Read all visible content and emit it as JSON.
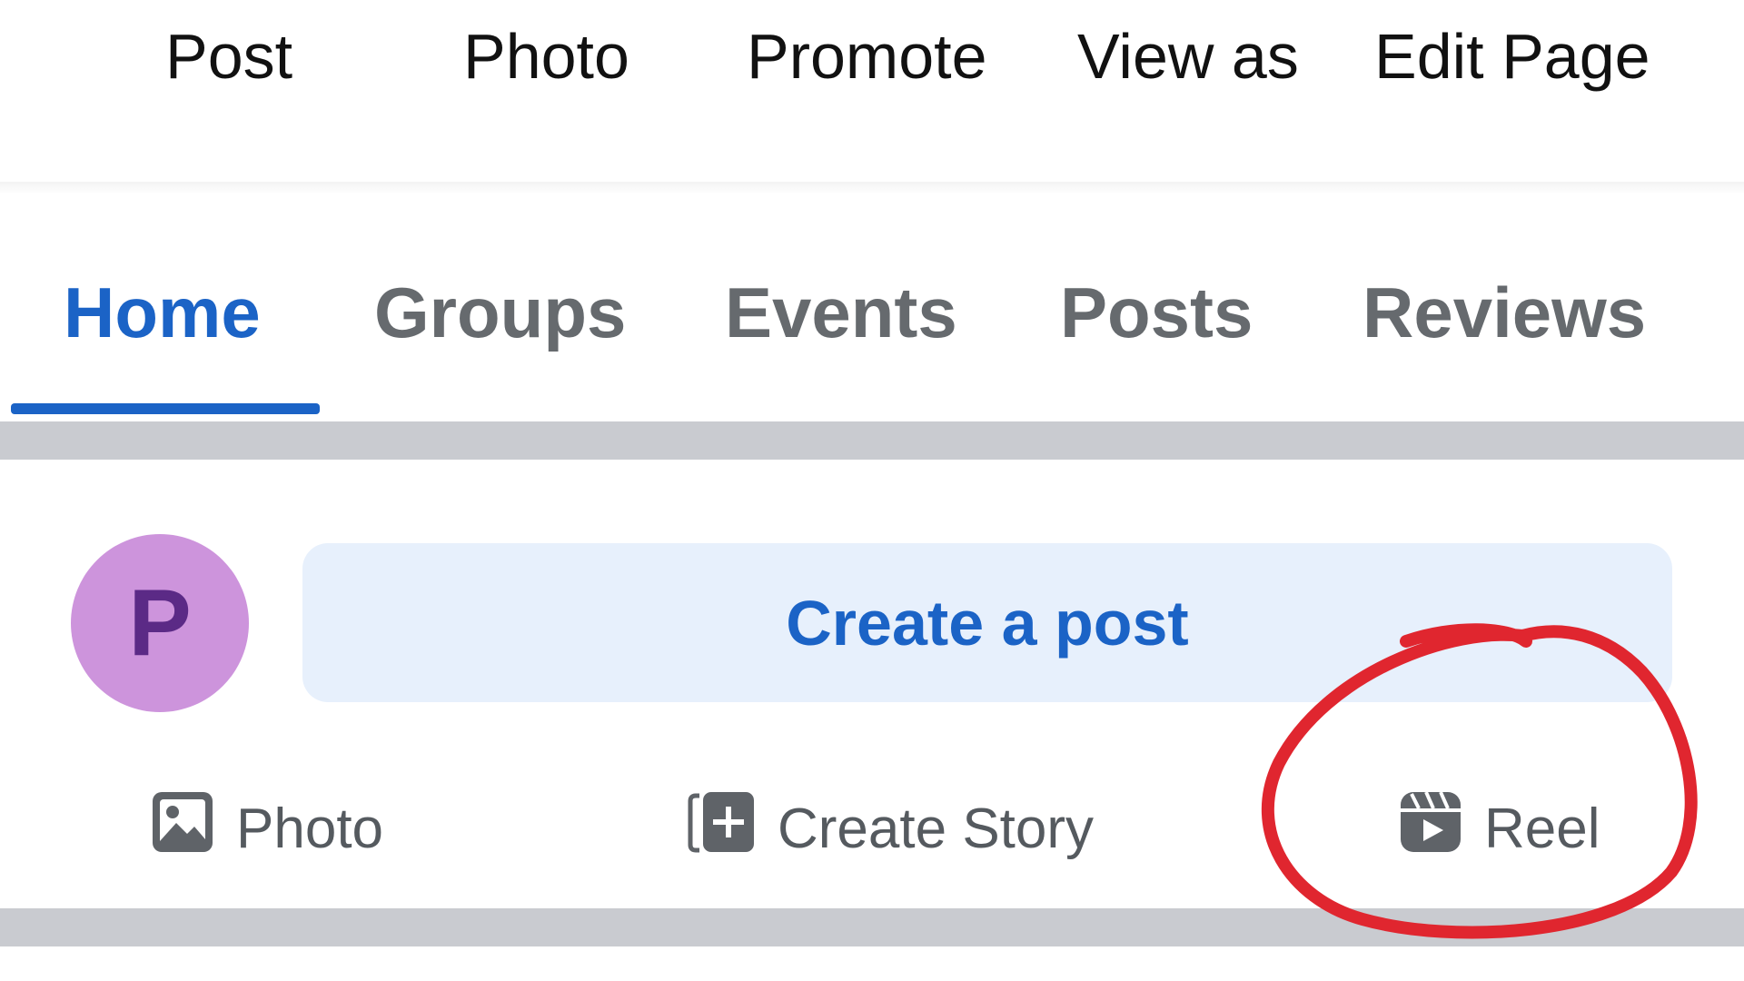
{
  "action_bar": {
    "items": [
      "Post",
      "Photo",
      "Promote",
      "View as",
      "Edit Page"
    ]
  },
  "tabs": {
    "items": [
      "Home",
      "Groups",
      "Events",
      "Posts",
      "Reviews"
    ],
    "active": "Home"
  },
  "composer": {
    "avatar_letter": "P",
    "avatar_color": "#cd94dc",
    "create_post_label": "Create a post",
    "actions": [
      {
        "label": "Photo",
        "icon": "photo-icon"
      },
      {
        "label": "Create Story",
        "icon": "create-story-icon"
      },
      {
        "label": "Reel",
        "icon": "reel-icon"
      }
    ]
  },
  "colors": {
    "accent": "#1b63c6",
    "tab_inactive": "#666a6e",
    "annotation": "#e0262f",
    "separator": "#c9cbd0"
  }
}
